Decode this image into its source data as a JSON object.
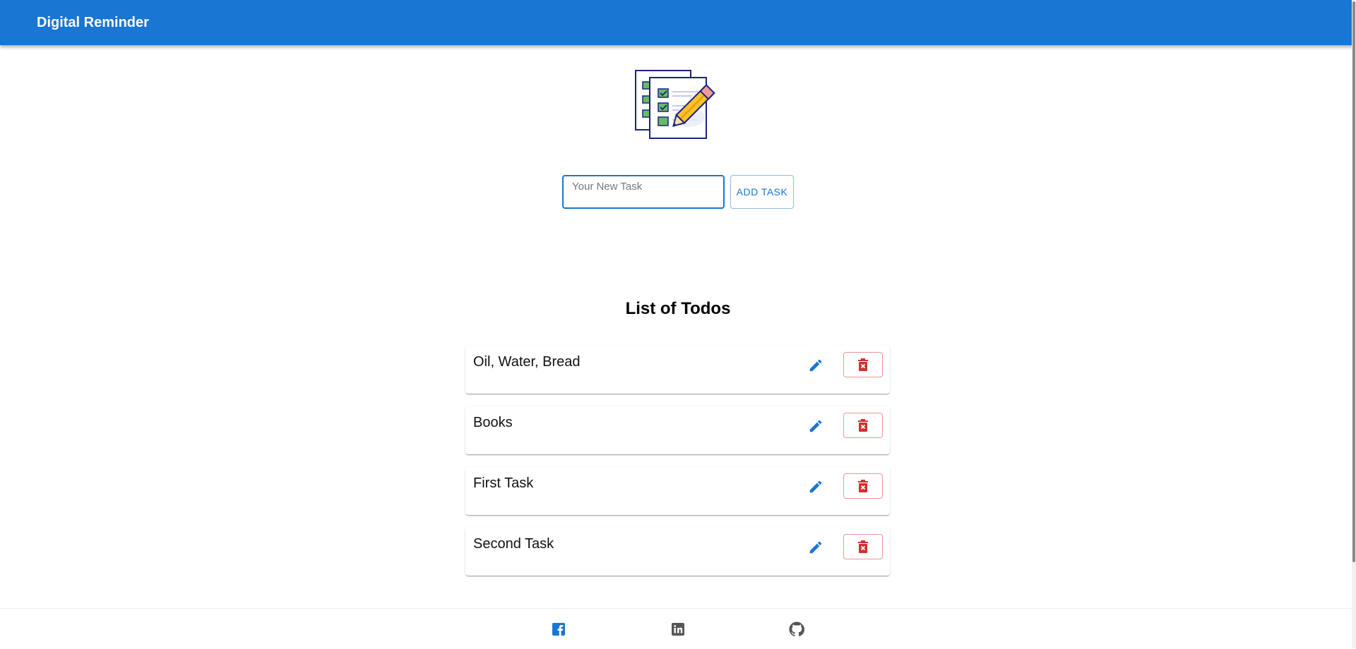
{
  "app": {
    "title": "Digital Reminder",
    "accent_color": "#1976d2",
    "danger_color": "#d32f2f"
  },
  "logo": {
    "icon": "todo-checklist-pencil-illustration"
  },
  "new_task": {
    "placeholder": "Your New Task",
    "value": "",
    "add_label": "ADD TASK"
  },
  "list": {
    "title": "List of Todos",
    "items": [
      {
        "text": "Oil, Water, Bread"
      },
      {
        "text": "Books"
      },
      {
        "text": "First Task"
      },
      {
        "text": "Second Task"
      }
    ],
    "edit_icon": "pencil-icon",
    "delete_icon": "trash-x-icon"
  },
  "footer": {
    "links": [
      {
        "icon": "facebook-icon",
        "color": "#1976d2"
      },
      {
        "icon": "linkedin-icon",
        "color": "#555555"
      },
      {
        "icon": "github-icon",
        "color": "#555555"
      }
    ]
  }
}
